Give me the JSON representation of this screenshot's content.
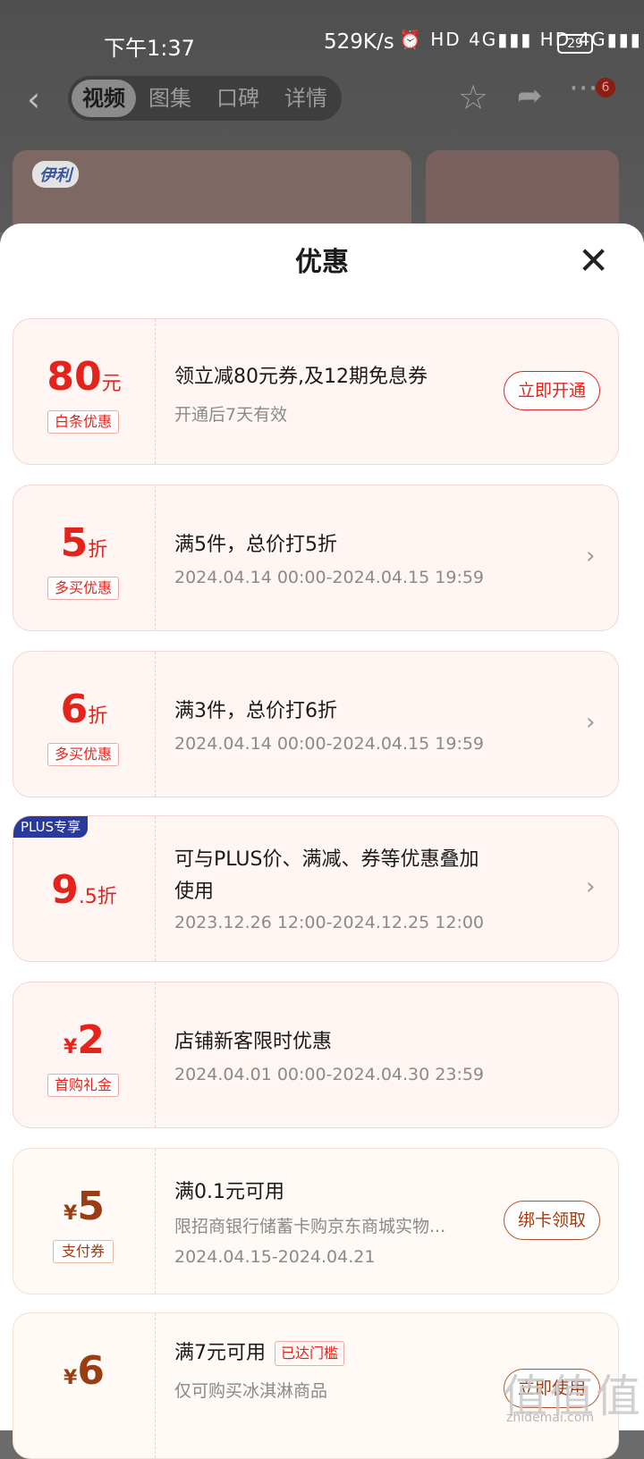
{
  "status_bar": {
    "time": "下午1:37",
    "speed": "529K/s",
    "icons": "⏰ HD 4G▮▮▮ HD 4G▮▮▮",
    "battery": "29"
  },
  "nav": {
    "tabs": [
      {
        "label": "视频",
        "active": true
      },
      {
        "label": "图集",
        "active": false
      },
      {
        "label": "口碑",
        "active": false
      },
      {
        "label": "详情",
        "active": false
      }
    ],
    "more_badge": "6"
  },
  "banner": {
    "logo": "伊利"
  },
  "sheet": {
    "title": "优惠"
  },
  "offers": [
    {
      "amount": "80",
      "suffix": "元",
      "tag": "白条优惠",
      "title": "领立减80元券,及12期免息券",
      "subtitle": "开通后7天有效",
      "button": "立即开通"
    },
    {
      "amount": "5",
      "suffix": "折",
      "tag": "多买优惠",
      "title": "满5件，总价打5折",
      "subtitle": "2024.04.14 00:00-2024.04.15 19:59"
    },
    {
      "amount": "6",
      "suffix": "折",
      "tag": "多买优惠",
      "title": "满3件，总价打6折",
      "subtitle": "2024.04.14 00:00-2024.04.15 19:59"
    },
    {
      "badge": "PLUS专享",
      "amount": "9",
      "suffix": ".5折",
      "title_line1": "可与PLUS价、满减、券等优惠叠加",
      "title_line2": "使用",
      "subtitle": "2023.12.26 12:00-2024.12.25 12:00"
    },
    {
      "prefix": "¥",
      "amount": "2",
      "tag": "首购礼金",
      "title": "店铺新客限时优惠",
      "subtitle": "2024.04.01 00:00-2024.04.30 23:59"
    },
    {
      "prefix": "¥",
      "amount": "5",
      "tag": "支付券",
      "title": "满0.1元可用",
      "subtitle": "限招商银行储蓄卡购京东商城实物...",
      "subtitle2": "2024.04.15-2024.04.21",
      "button": "绑卡领取"
    },
    {
      "prefix": "¥",
      "amount": "6",
      "title": "满7元可用",
      "mini_tag": "已达门槛",
      "subtitle": "仅可购买冰淇淋商品",
      "button": "立即使用"
    }
  ],
  "watermark": {
    "text": "值值值",
    "url": "zhidemai.com"
  },
  "colors": {
    "accent": "#e4231c",
    "brown": "#9b3d12",
    "plus": "#2a3a9c"
  }
}
